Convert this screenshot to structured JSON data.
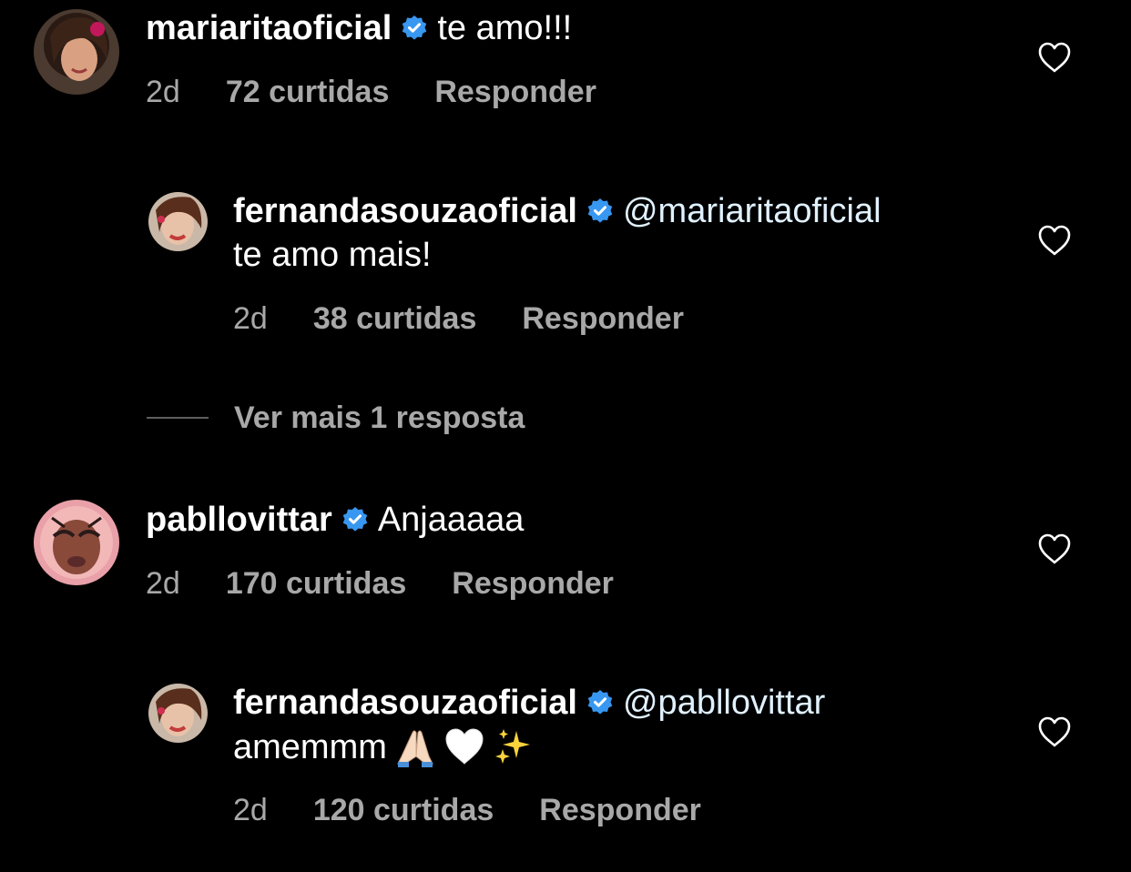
{
  "comments": [
    {
      "username": "mariaritaoficial",
      "text": "te amo!!!",
      "age": "2d",
      "likes": "72 curtidas",
      "reply_label": "Responder",
      "avatar": "profile-photo-mariaritaoficial"
    },
    {
      "username": "fernandasouzaoficial",
      "mention": "@mariaritaoficial",
      "text": "te amo mais!",
      "age": "2d",
      "likes": "38 curtidas",
      "reply_label": "Responder",
      "avatar": "profile-photo-fernandasouzaoficial"
    },
    {
      "username": "pabllovittar",
      "text": "Anjaaaaa",
      "age": "2d",
      "likes": "170 curtidas",
      "reply_label": "Responder",
      "avatar": "profile-illustration-pabllovittar"
    },
    {
      "username": "fernandasouzaoficial",
      "mention": "@pabllovittar",
      "text": "amemmm",
      "emojis": [
        "folded-hands-emoji",
        "white-heart-emoji",
        "sparkles-emoji"
      ],
      "age": "2d",
      "likes": "120 curtidas",
      "reply_label": "Responder",
      "avatar": "profile-photo-fernandasouzaoficial"
    }
  ],
  "more_replies": {
    "label": "Ver mais 1 resposta"
  },
  "icons": {
    "verified": "verified-badge-icon",
    "like": "heart-outline-icon"
  },
  "colors": {
    "background": "#000000",
    "text": "#ffffff",
    "meta": "#a8a8a8",
    "verified_badge": "#3897f0"
  }
}
